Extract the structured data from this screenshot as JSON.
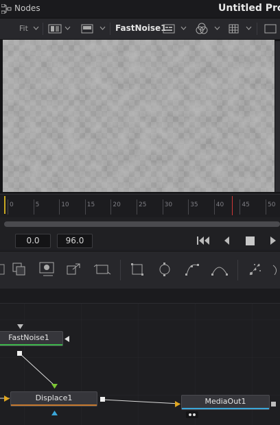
{
  "titlebar": {
    "panel_label": "Nodes",
    "project_title": "Untitled Proj"
  },
  "viewer_toolbar": {
    "fit_label": "Fit",
    "node_name": "FastNoise1"
  },
  "ruler": {
    "ticks": [
      "0",
      "5",
      "10",
      "15",
      "20",
      "25",
      "30",
      "35",
      "40",
      "45",
      "50"
    ],
    "playhead_frame": 42
  },
  "transport": {
    "start_time": "0.0",
    "end_time": "96.0"
  },
  "nodes": {
    "fastnoise": "FastNoise1",
    "displace": "Displace1",
    "mediaout": "MediaOut1"
  },
  "icons": [
    "nodes-icon",
    "layout-icon",
    "viewer-icon",
    "chevron-down-icon",
    "color-icon",
    "grid-icon",
    "first-frame-icon",
    "prev-frame-icon",
    "stop-icon",
    "play-icon",
    "rectangle-icon",
    "ellipse-icon",
    "polygon-icon",
    "bspline-icon",
    "particle-icon"
  ],
  "colors": {
    "accent_playhead": "#d33838",
    "cache_line": "#c8a820",
    "node_green": "#3db54a",
    "node_orange": "#c8792c",
    "node_blue": "#3ba6d8"
  }
}
